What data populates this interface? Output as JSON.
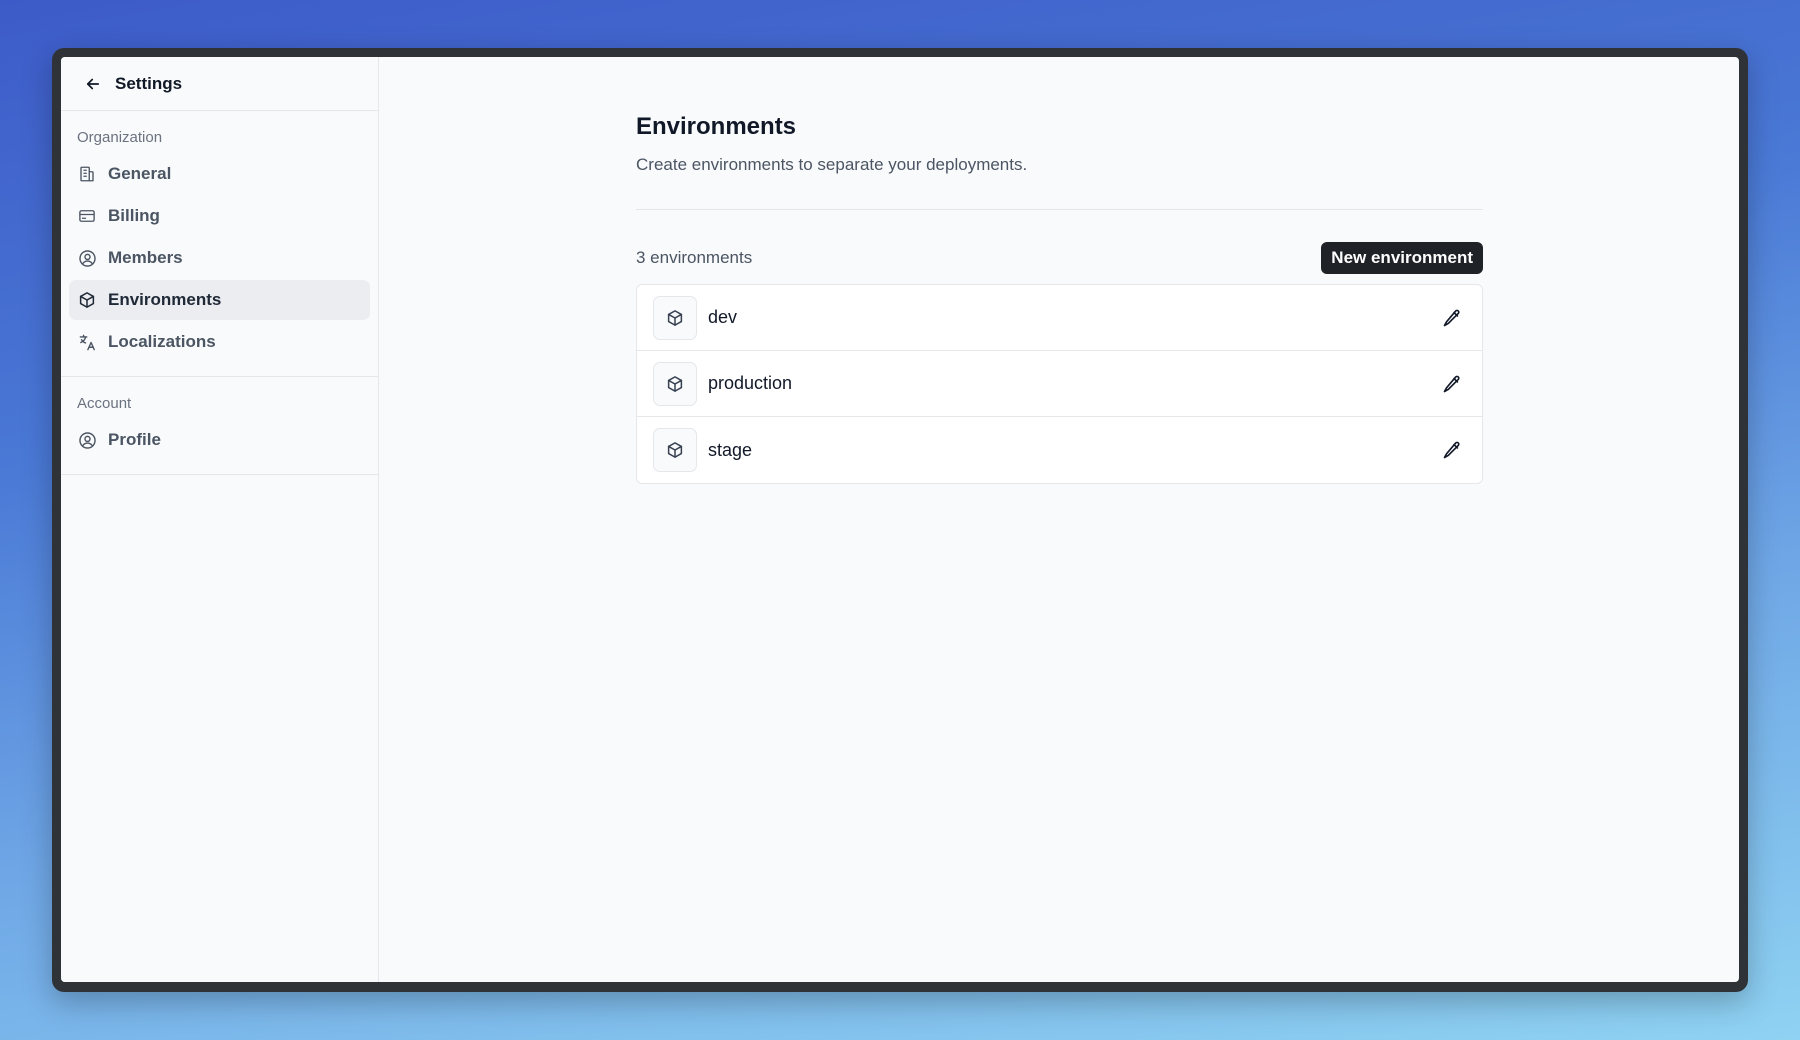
{
  "sidebar": {
    "title": "Settings",
    "sections": [
      {
        "label": "Organization",
        "items": [
          {
            "label": "General",
            "icon": "building-icon"
          },
          {
            "label": "Billing",
            "icon": "credit-card-icon"
          },
          {
            "label": "Members",
            "icon": "user-circle-icon"
          },
          {
            "label": "Environments",
            "icon": "cube-icon",
            "active": true
          },
          {
            "label": "Localizations",
            "icon": "translate-icon"
          }
        ]
      },
      {
        "label": "Account",
        "items": [
          {
            "label": "Profile",
            "icon": "user-circle-icon"
          }
        ]
      }
    ]
  },
  "main": {
    "title": "Environments",
    "subtitle": "Create environments to separate your deployments.",
    "count_label": "3 environments",
    "new_button_label": "New environment",
    "environments": [
      {
        "name": "dev"
      },
      {
        "name": "production"
      },
      {
        "name": "stage"
      }
    ]
  },
  "colors": {
    "primary_button_bg": "#1f2227",
    "active_nav_bg": "#ebedf0"
  }
}
